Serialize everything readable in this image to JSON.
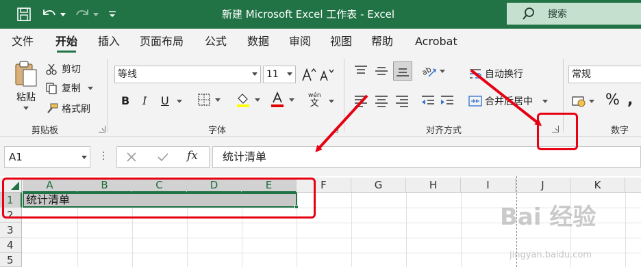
{
  "window": {
    "title": "新建 Microsoft Excel 工作表  -  Excel",
    "search_label": "搜索"
  },
  "tabs": [
    {
      "label": "文件",
      "active": false
    },
    {
      "label": "开始",
      "active": true
    },
    {
      "label": "插入",
      "active": false
    },
    {
      "label": "页面布局",
      "active": false
    },
    {
      "label": "公式",
      "active": false
    },
    {
      "label": "数据",
      "active": false
    },
    {
      "label": "审阅",
      "active": false
    },
    {
      "label": "视图",
      "active": false
    },
    {
      "label": "帮助",
      "active": false
    },
    {
      "label": "Acrobat",
      "active": false
    }
  ],
  "ribbon": {
    "clipboard": {
      "group_label": "剪贴板",
      "paste": "粘贴",
      "cut": "剪切",
      "copy": "复制",
      "format_painter": "格式刷"
    },
    "font": {
      "group_label": "字体",
      "font_name": "等线",
      "font_size": "11",
      "bold": "B",
      "italic": "I",
      "underline": "U",
      "phonetic_top": "wén",
      "phonetic_bottom": "文"
    },
    "alignment": {
      "group_label": "对齐方式",
      "wrap_text": "自动换行",
      "merge_center": "合并后居中"
    },
    "number": {
      "group_label": "数字",
      "format": "常规",
      "percent": "%"
    }
  },
  "formula_bar": {
    "name_box": "A1",
    "fx": "fx",
    "content": "统计清单"
  },
  "sheet": {
    "columns": [
      "A",
      "B",
      "C",
      "D",
      "E",
      "F",
      "G",
      "H",
      "I",
      "J",
      "K"
    ],
    "rows": [
      "1",
      "2",
      "3",
      "4",
      "5"
    ],
    "cells": {
      "A1": "统计清单"
    }
  },
  "watermark": {
    "brand": "Bai 经验",
    "url": "jingyan.baidu.com"
  },
  "colors": {
    "excel_green": "#217346",
    "annotation_red": "#e60012"
  }
}
